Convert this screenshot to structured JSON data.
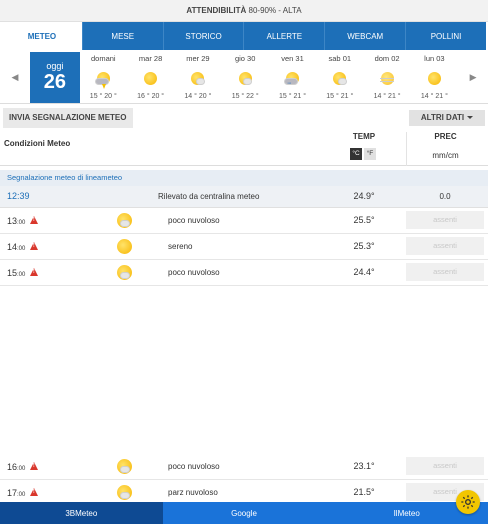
{
  "reliability": {
    "label": "ATTENDIBILITÀ",
    "value": "80-90% - ALTA"
  },
  "tabs": [
    {
      "label": "METEO",
      "active": true
    },
    {
      "label": "MESE"
    },
    {
      "label": "STORICO"
    },
    {
      "label": "ALLERTE"
    },
    {
      "label": "WEBCAM"
    },
    {
      "label": "POLLINI"
    }
  ],
  "days": {
    "prev_arrow": "◀",
    "next_arrow": "▶",
    "today": {
      "name": "oggi",
      "number": "26"
    },
    "list": [
      {
        "name": "domani",
        "icon": "storm-icon",
        "temps": "15 ° 20 °"
      },
      {
        "name": "mar 28",
        "icon": "sun-icon",
        "temps": "16 ° 20 °"
      },
      {
        "name": "mer 29",
        "icon": "partly-cloudy-icon",
        "temps": "14 ° 20 °"
      },
      {
        "name": "gio 30",
        "icon": "partly-cloudy-icon",
        "temps": "15 ° 22 °"
      },
      {
        "name": "ven 31",
        "icon": "rain-storm-icon",
        "temps": "15 ° 21 °"
      },
      {
        "name": "sab 01",
        "icon": "partly-cloudy-icon",
        "temps": "15 ° 21 °"
      },
      {
        "name": "dom 02",
        "icon": "hazy-sun-icon",
        "temps": "14 ° 21 °"
      },
      {
        "name": "lun 03",
        "icon": "sun-icon",
        "temps": "14 ° 21 °"
      }
    ]
  },
  "actions": {
    "send_label": "INVIA SEGNALAZIONE METEO",
    "more_label": "ALTRI DATI"
  },
  "table": {
    "cond_header": "Condizioni Meteo",
    "temp_header": "TEMP",
    "unit_c": "°C",
    "unit_f": "°F",
    "prec_header": "PREC",
    "prec_unit": "mm/cm"
  },
  "report": {
    "section_title": "Segnalazione meteo di lineameteo",
    "time": "12:39",
    "source": "Rilevato da centralina meteo",
    "temp": "24.9°",
    "prec": "0.0"
  },
  "hours": [
    {
      "hour": "13",
      "min": ":00",
      "icon": "partly-cloudy-icon",
      "desc": "poco nuvoloso",
      "temp": "25.5°",
      "prec": "assenti"
    },
    {
      "hour": "14",
      "min": ":00",
      "icon": "sun-icon",
      "desc": "sereno",
      "temp": "25.3°",
      "prec": "assenti"
    },
    {
      "hour": "15",
      "min": ":00",
      "icon": "partly-cloudy-icon",
      "desc": "poco nuvoloso",
      "temp": "24.4°",
      "prec": "assenti"
    }
  ],
  "hours_bottom": [
    {
      "hour": "16",
      "min": ":00",
      "icon": "partly-cloudy-icon",
      "desc": "poco nuvoloso",
      "temp": "23.1°",
      "prec": "assenti"
    },
    {
      "hour": "17",
      "min": ":00",
      "icon": "partly-cloudy-icon",
      "desc": "parz nuvoloso",
      "temp": "21.5°",
      "prec": "assenti"
    }
  ],
  "bottom_nav": [
    {
      "label": "3BMeteo"
    },
    {
      "label": "Google"
    },
    {
      "label": "IlMeteo"
    }
  ]
}
